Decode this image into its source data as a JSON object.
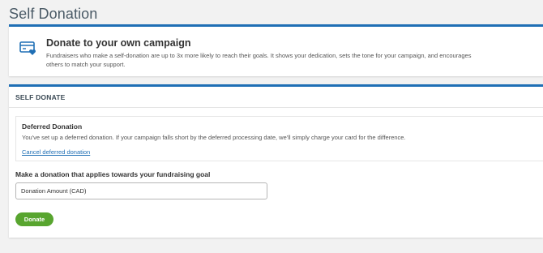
{
  "page": {
    "title": "Self Donation"
  },
  "intro": {
    "icon": "credit-card-heart-icon",
    "title": "Donate to your own campaign",
    "text": "Fundraisers who make a self-donation are up to 3x more likely to reach their goals. It shows your dedication, sets the tone for your campaign, and encourages others to match your support."
  },
  "self_donate": {
    "header": "SELF DONATE",
    "deferred": {
      "title": "Deferred Donation",
      "text": "You've set up a deferred donation. If your campaign falls short by the deferred processing date, we'll simply charge your card for the difference.",
      "cancel_link": "Cancel deferred donation"
    },
    "goal_label": "Make a donation that applies towards your fundraising goal",
    "amount_placeholder": "Donation Amount (CAD)",
    "donate_button": "Donate"
  },
  "colors": {
    "accent": "#1f6fb5",
    "button": "#58a52f",
    "background": "#f2f2f2"
  }
}
